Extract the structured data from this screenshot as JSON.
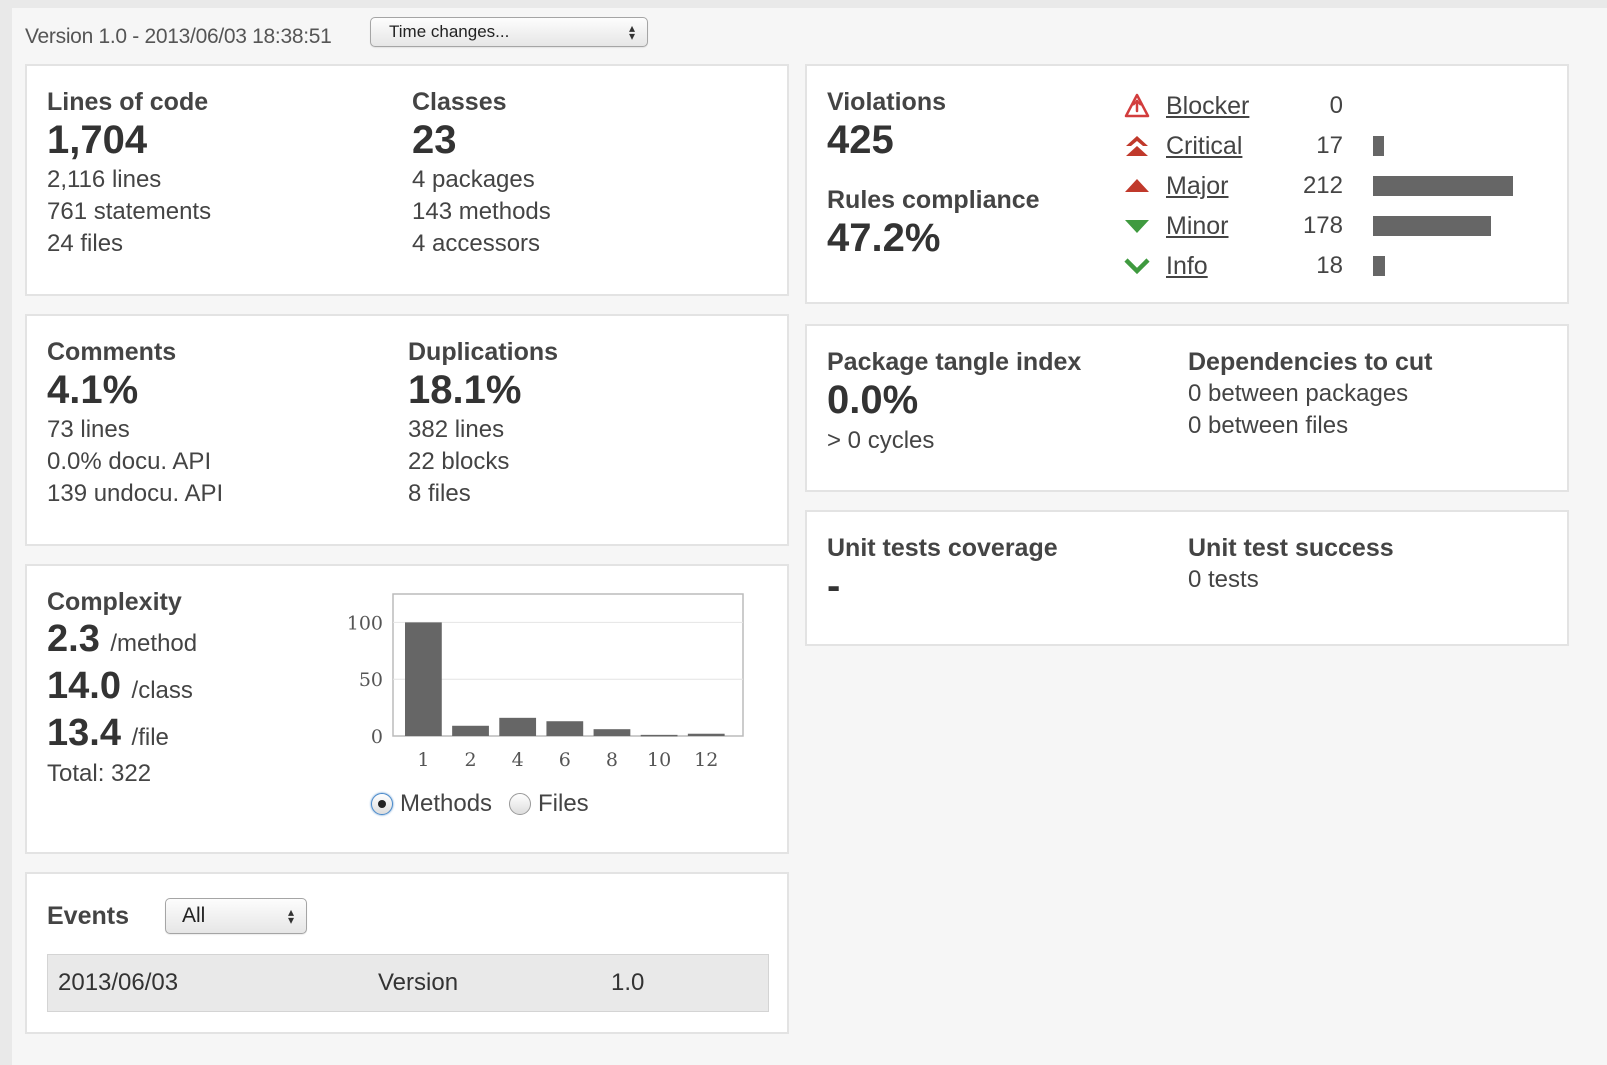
{
  "header": {
    "version": "Version 1.0 - 2013/06/03 18:38:51",
    "time_changes": "Time changes..."
  },
  "size": {
    "lines_of_code_label": "Lines of code",
    "lines_of_code": "1,704",
    "lines": "2,116 lines",
    "statements": "761 statements",
    "files": "24 files",
    "classes_label": "Classes",
    "classes": "23",
    "packages": "4 packages",
    "methods": "143 methods",
    "accessors": "4 accessors"
  },
  "comments": {
    "comments_label": "Comments",
    "comments": "4.1%",
    "comment_lines": "73 lines",
    "docu_api": "0.0% docu. API",
    "undocu_api": "139 undocu. API",
    "duplications_label": "Duplications",
    "duplications": "18.1%",
    "dup_lines": "382 lines",
    "dup_blocks": "22 blocks",
    "dup_files": "8 files"
  },
  "complexity": {
    "label": "Complexity",
    "per_method": "2.3",
    "per_method_unit": "/method",
    "per_class": "14.0",
    "per_class_unit": "/class",
    "per_file": "13.4",
    "per_file_unit": "/file",
    "total": "Total: 322",
    "radio_methods": "Methods",
    "radio_files": "Files",
    "selected": "Methods"
  },
  "chart_data": {
    "type": "bar",
    "categories": [
      "1",
      "2",
      "4",
      "6",
      "8",
      "10",
      "12"
    ],
    "values": [
      100,
      9,
      16,
      13,
      6,
      1,
      2
    ],
    "title": "",
    "xlabel": "",
    "ylabel": "",
    "ylim": [
      0,
      100
    ],
    "yticks": [
      "100",
      "50",
      "0"
    ],
    "grid": true,
    "bar_color": "#666666"
  },
  "events": {
    "label": "Events",
    "filter": "All",
    "rows": [
      {
        "date": "2013/06/03",
        "category": "Version",
        "name": "1.0"
      }
    ]
  },
  "violations": {
    "label": "Violations",
    "count": "425",
    "compliance_label": "Rules compliance",
    "compliance": "47.2%",
    "severities": [
      {
        "name": "Blocker",
        "count": "0",
        "value": 0,
        "icon": "blocker-icon",
        "color": "#d23c3c"
      },
      {
        "name": "Critical",
        "count": "17",
        "value": 17,
        "icon": "critical-icon",
        "color": "#c0392b"
      },
      {
        "name": "Major",
        "count": "212",
        "value": 212,
        "icon": "major-icon",
        "color": "#c0392b"
      },
      {
        "name": "Minor",
        "count": "178",
        "value": 178,
        "icon": "minor-icon",
        "color": "#3f9a3f"
      },
      {
        "name": "Info",
        "count": "18",
        "value": 18,
        "icon": "info-icon",
        "color": "#3f9a3f"
      }
    ]
  },
  "design": {
    "tangle_label": "Package tangle index",
    "tangle": "0.0%",
    "cycles": "> 0 cycles",
    "deps_label": "Dependencies to cut",
    "between_packages": "0 between packages",
    "between_files": "0 between files"
  },
  "tests": {
    "coverage_label": "Unit tests coverage",
    "coverage": "-",
    "success_label": "Unit test success",
    "tests": "0 tests"
  }
}
